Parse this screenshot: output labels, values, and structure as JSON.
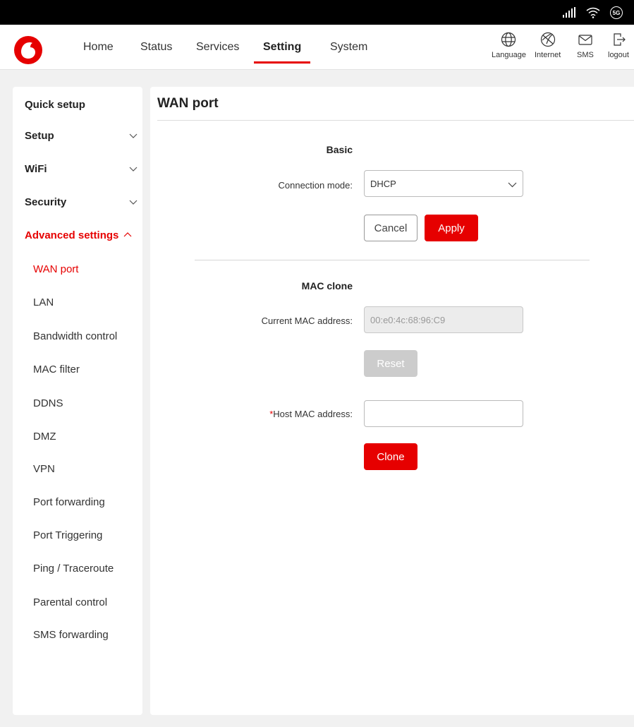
{
  "statusbar": {
    "network_badge": "5G",
    "icons": [
      "signal-bars-icon",
      "wifi-icon",
      "5g-badge-icon"
    ]
  },
  "brand": {
    "accent": "#e60000"
  },
  "nav": {
    "items": [
      {
        "label": "Home"
      },
      {
        "label": "Status"
      },
      {
        "label": "Services"
      },
      {
        "label": "Setting"
      },
      {
        "label": "System"
      }
    ],
    "active": "Setting"
  },
  "header_tools": [
    {
      "label": "Language",
      "icon": "globe-icon"
    },
    {
      "label": "Internet",
      "icon": "internet-icon"
    },
    {
      "label": "SMS",
      "icon": "envelope-icon"
    },
    {
      "label": "logout",
      "icon": "logout-icon"
    }
  ],
  "sidebar": {
    "sections": [
      {
        "label": "Quick setup"
      },
      {
        "label": "Setup"
      },
      {
        "label": "WiFi"
      },
      {
        "label": "Security"
      },
      {
        "label": "Advanced settings"
      }
    ],
    "sub_items": [
      {
        "label": "WAN port"
      },
      {
        "label": "LAN"
      },
      {
        "label": "Bandwidth control"
      },
      {
        "label": "MAC filter"
      },
      {
        "label": "DDNS"
      },
      {
        "label": "DMZ"
      },
      {
        "label": "VPN"
      },
      {
        "label": "Port forwarding"
      },
      {
        "label": "Port Triggering"
      },
      {
        "label": "Ping / Traceroute"
      },
      {
        "label": "Parental control"
      },
      {
        "label": "SMS forwarding"
      }
    ]
  },
  "page": {
    "title": "WAN port",
    "basic": {
      "section_title": "Basic",
      "connection_mode_label": "Connection mode:",
      "connection_mode_value": "DHCP",
      "cancel_label": "Cancel",
      "apply_label": "Apply"
    },
    "mac_clone": {
      "section_title": "MAC clone",
      "current_mac_label": "Current MAC address:",
      "current_mac_value": "00:e0:4c:68:96:C9",
      "reset_label": "Reset",
      "required_mark": "*",
      "host_mac_label": "Host MAC address:",
      "host_mac_value": "",
      "clone_label": "Clone"
    }
  }
}
